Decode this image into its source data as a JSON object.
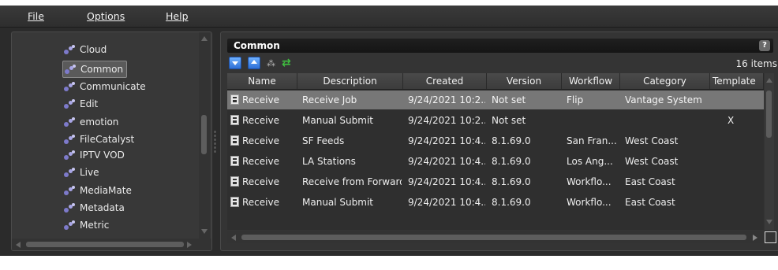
{
  "menu": {
    "file": "File",
    "options": "Options",
    "help": "Help"
  },
  "left_panel": {
    "items": [
      {
        "label": "Cloud",
        "selected": false
      },
      {
        "label": "Common",
        "selected": true
      },
      {
        "label": "Communicate",
        "selected": false
      },
      {
        "label": "Edit",
        "selected": false
      },
      {
        "label": "emotion",
        "selected": false
      },
      {
        "label": "FileCatalyst",
        "selected": false
      },
      {
        "label": "IPTV VOD",
        "selected": false
      },
      {
        "label": "Live",
        "selected": false
      },
      {
        "label": "MediaMate",
        "selected": false
      },
      {
        "label": "Metadata",
        "selected": false
      },
      {
        "label": "Metric",
        "selected": false
      }
    ]
  },
  "right_panel": {
    "title": "Common",
    "help_label": "?",
    "item_count": "16 items",
    "toolbar": {
      "icons": [
        "move-down-icon",
        "move-up-icon",
        "workflow-graph-icon",
        "refresh-icon"
      ],
      "graph_glyph": "⁂",
      "refresh_glyph": "⇄"
    },
    "columns": [
      "Name",
      "Description",
      "Created",
      "Version",
      "Workflow",
      "Category",
      "Template"
    ],
    "rows": [
      {
        "name": "Receive",
        "description": "Receive Job",
        "created": "9/24/2021 10:2...",
        "version": "Not set",
        "workflow": "Flip",
        "category": "Vantage System",
        "template": "",
        "selected": true
      },
      {
        "name": "Receive",
        "description": "Manual Submit",
        "created": "9/24/2021 10:2...",
        "version": "Not set",
        "workflow": "",
        "category": "",
        "template": "X",
        "selected": false
      },
      {
        "name": "Receive",
        "description": "SF Feeds",
        "created": "9/24/2021 10:4...",
        "version": "8.1.69.0",
        "workflow": "San Fran...",
        "category": "West Coast",
        "template": "",
        "selected": false
      },
      {
        "name": "Receive",
        "description": "LA Stations",
        "created": "9/24/2021 10:4...",
        "version": "8.1.69.0",
        "workflow": "Los Ang...",
        "category": "West Coast",
        "template": "",
        "selected": false
      },
      {
        "name": "Receive",
        "description": "Receive from Forward",
        "created": "9/24/2021 10:4...",
        "version": "8.1.69.0",
        "workflow": "Workflo...",
        "category": "East Coast",
        "template": "",
        "selected": false
      },
      {
        "name": "Receive",
        "description": "Manual Submit",
        "created": "9/24/2021 10:4...",
        "version": "8.1.69.0",
        "workflow": "Workflo...",
        "category": "East Coast",
        "template": "",
        "selected": false
      }
    ]
  },
  "colors": {
    "background": "#2b2b2b",
    "selected_row": "#777777",
    "header_bar": "#1a1a1a",
    "accent_blue": "#2d6fd6",
    "refresh_green": "#3fc03f"
  }
}
